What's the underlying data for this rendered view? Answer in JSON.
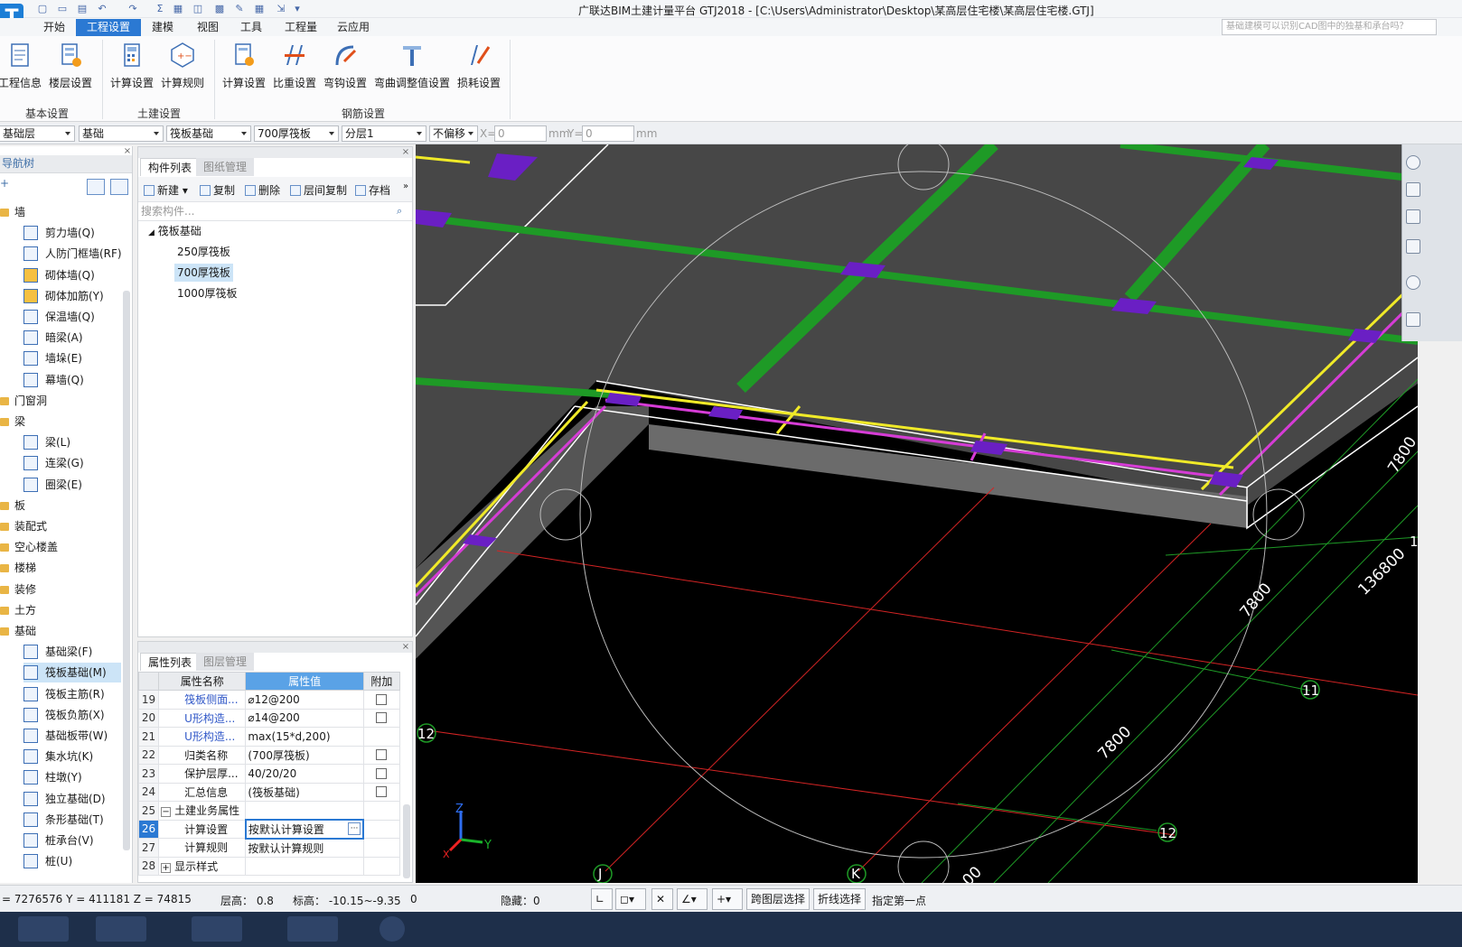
{
  "app": {
    "title": "广联达BIM土建计量平台 GTJ2018 - [C:\\Users\\Administrator\\Desktop\\某高层住宅楼\\某高层住宅楼.GTJ]",
    "logo_letter": "T"
  },
  "menu": {
    "tabs": [
      "开始",
      "工程设置",
      "建模",
      "视图",
      "工具",
      "工程量",
      "云应用"
    ],
    "active": "工程设置",
    "search_placeholder": "基础建模可以识别CAD图中的独基和承台吗？"
  },
  "ribbon": {
    "buttons": [
      "工程信息",
      "楼层设置",
      "计算设置",
      "计算规则",
      "计算设置",
      "比重设置",
      "弯钩设置",
      "弯曲调整值设置",
      "损耗设置"
    ],
    "groups": [
      "基本设置",
      "土建设置",
      "钢筋设置"
    ]
  },
  "selectors": {
    "floor": "基础层",
    "category": "基础",
    "type": "筏板基础",
    "component": "700厚筏板",
    "layer": "分层1",
    "offset_mode": "不偏移",
    "x_label": "X=",
    "x_value": "0",
    "x_unit": "mm",
    "y_label": "Y=",
    "y_value": "0",
    "y_unit": "mm"
  },
  "nav": {
    "title": "导航树",
    "items": [
      {
        "label": "墙",
        "level": 0
      },
      {
        "label": "剪力墙(Q)",
        "level": 1
      },
      {
        "label": "人防门框墙(RF)",
        "level": 1
      },
      {
        "label": "砌体墙(Q)",
        "level": 1
      },
      {
        "label": "砌体加筋(Y)",
        "level": 1
      },
      {
        "label": "保温墙(Q)",
        "level": 1
      },
      {
        "label": "暗梁(A)",
        "level": 1
      },
      {
        "label": "墙垛(E)",
        "level": 1
      },
      {
        "label": "幕墙(Q)",
        "level": 1
      },
      {
        "label": "门窗洞",
        "level": 0
      },
      {
        "label": "梁",
        "level": 0
      },
      {
        "label": "梁(L)",
        "level": 1
      },
      {
        "label": "连梁(G)",
        "level": 1
      },
      {
        "label": "圈梁(E)",
        "level": 1
      },
      {
        "label": "板",
        "level": 0
      },
      {
        "label": "装配式",
        "level": 0
      },
      {
        "label": "空心楼盖",
        "level": 0
      },
      {
        "label": "楼梯",
        "level": 0
      },
      {
        "label": "装修",
        "level": 0
      },
      {
        "label": "土方",
        "level": 0
      },
      {
        "label": "基础",
        "level": 0
      },
      {
        "label": "基础梁(F)",
        "level": 1
      },
      {
        "label": "筏板基础(M)",
        "level": 1
      },
      {
        "label": "筏板主筋(R)",
        "level": 1
      },
      {
        "label": "筏板负筋(X)",
        "level": 1
      },
      {
        "label": "基础板带(W)",
        "level": 1
      },
      {
        "label": "集水坑(K)",
        "level": 1
      },
      {
        "label": "柱墩(Y)",
        "level": 1
      },
      {
        "label": "独立基础(D)",
        "level": 1
      },
      {
        "label": "条形基础(T)",
        "level": 1
      },
      {
        "label": "桩承台(V)",
        "level": 1
      },
      {
        "label": "桩(U)",
        "level": 1
      }
    ],
    "selected": "筏板基础(M)"
  },
  "component_list": {
    "tabs": [
      "构件列表",
      "图纸管理"
    ],
    "toolbar": [
      "新建",
      "复制",
      "删除",
      "层间复制",
      "存档"
    ],
    "search_placeholder": "搜索构件...",
    "group": "筏板基础",
    "items": [
      "250厚筏板",
      "700厚筏板",
      "1000厚筏板"
    ],
    "selected": "700厚筏板"
  },
  "properties": {
    "tabs": [
      "属性列表",
      "图层管理"
    ],
    "headers": [
      "属性名称",
      "属性值",
      "附加"
    ],
    "rows": [
      {
        "num": "19",
        "name": "筏板侧面...",
        "value": "⌀12@200",
        "link": true,
        "check": true
      },
      {
        "num": "20",
        "name": "U形构造...",
        "value": "⌀14@200",
        "link": true,
        "check": true
      },
      {
        "num": "21",
        "name": "U形构造...",
        "value": "max(15*d,200)",
        "link": true,
        "check": false
      },
      {
        "num": "22",
        "name": "归类名称",
        "value": "(700厚筏板)",
        "link": false,
        "check": true
      },
      {
        "num": "23",
        "name": "保护层厚...",
        "value": "40/20/20",
        "link": false,
        "check": true
      },
      {
        "num": "24",
        "name": "汇总信息",
        "value": "(筏板基础)",
        "link": false,
        "check": true
      },
      {
        "num": "25",
        "name": "土建业务属性",
        "value": "",
        "link": false,
        "check": false,
        "group": true,
        "sign": "−"
      },
      {
        "num": "26",
        "name": "计算设置",
        "value": "按默认计算设置",
        "link": false,
        "check": false,
        "current": true
      },
      {
        "num": "27",
        "name": "计算规则",
        "value": "按默认计算规则",
        "link": false,
        "check": false
      },
      {
        "num": "28",
        "name": "显示样式",
        "value": "",
        "link": false,
        "check": false,
        "group": true,
        "sign": "+"
      }
    ]
  },
  "viewport": {
    "dimension_labels": [
      "7800",
      "136800",
      "7800",
      "7800",
      "00"
    ],
    "axis_labels": [
      "11",
      "12",
      "12",
      "J",
      "K",
      "1"
    ],
    "gizmo": [
      "Z",
      "Y",
      "X"
    ]
  },
  "status": {
    "coords": "= 7276576 Y = 411181 Z = 74815",
    "floor_height": "层高： 0.8",
    "elevation": "标高： -10.15~-9.35",
    "zero": "0",
    "hidden": "隐藏：0",
    "cross_layer": "跨图层选择",
    "polyline": "折线选择",
    "prompt": "指定第一点"
  },
  "colors": {
    "accent": "#2b79d3",
    "grid_green": "#1e9a26",
    "beam_yellow": "#f0ea28",
    "beam_magenta": "#d63cd6",
    "column_purple": "#6a1fc4",
    "axis_red": "#d42424"
  }
}
